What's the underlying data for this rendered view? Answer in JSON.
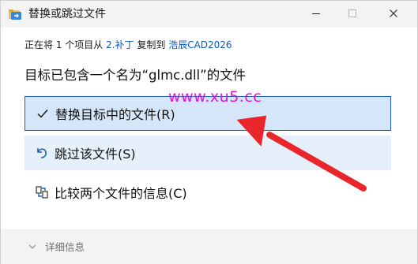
{
  "window": {
    "title": "替换或跳过文件"
  },
  "copy_status": {
    "prefix": "正在将 1 个项目从 ",
    "source": "2.补丁",
    "middle": " 复制到 ",
    "destination": "浩辰CAD2026"
  },
  "headline": "目标已包含一个名为“glmc.dll”的文件",
  "options": [
    {
      "label": "替换目标中的文件(R)",
      "icon": "checkmark-icon"
    },
    {
      "label": "跳过该文件(S)",
      "icon": "skip-icon"
    },
    {
      "label": "比较两个文件的信息(C)",
      "icon": "compare-icon"
    }
  ],
  "watermark": "www.xu5.cc",
  "footer": {
    "details_label": "详细信息"
  },
  "colors": {
    "accent": "#0a5ac2",
    "selected_bg": "#d4e6f8",
    "selected_border": "#1f5ea8",
    "hover_bg": "#e6f0fb",
    "watermark": "#d817d8",
    "arrow": "#e8262b"
  }
}
